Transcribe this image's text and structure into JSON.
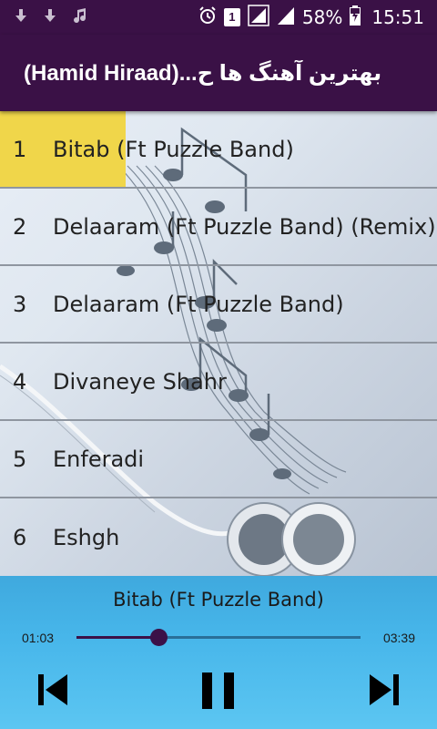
{
  "status_bar": {
    "battery_percent": "58%",
    "time": "15:51",
    "sim_badge": "1",
    "icons": [
      "download-icon",
      "download-icon",
      "music-note-icon",
      "alarm-icon",
      "sim-icon",
      "signal-icon",
      "signal-icon",
      "battery-icon"
    ]
  },
  "header": {
    "title": "بهترین آهنگ ها ح...(Hamid Hiraad)"
  },
  "songs": [
    {
      "num": "1",
      "title": "Bitab (Ft Puzzle Band)",
      "active": true
    },
    {
      "num": "2",
      "title": "Delaaram (Ft Puzzle Band) (Remix)",
      "active": false
    },
    {
      "num": "3",
      "title": "Delaaram (Ft Puzzle Band)",
      "active": false
    },
    {
      "num": "4",
      "title": "Divaneye Shahr",
      "active": false
    },
    {
      "num": "5",
      "title": "Enferadi",
      "active": false
    },
    {
      "num": "6",
      "title": "Eshgh",
      "active": false
    }
  ],
  "player": {
    "now_playing": "Bitab (Ft Puzzle Band)",
    "current_time": "01:03",
    "total_time": "03:39",
    "progress": 0.29,
    "controls": [
      "previous-icon",
      "pause-icon",
      "next-icon"
    ]
  },
  "colors": {
    "header_bg": "#3a1146",
    "active_highlight": "#f0d64a",
    "player_bg": "#47b6ea"
  }
}
